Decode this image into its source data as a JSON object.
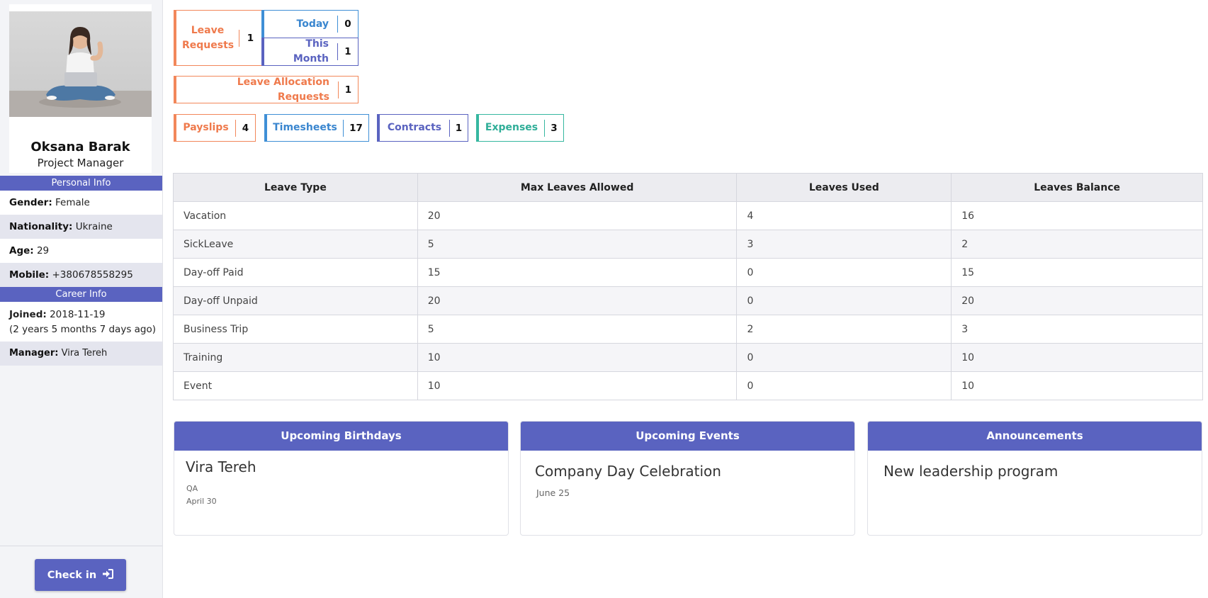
{
  "profile": {
    "name": "Oksana Barak",
    "role": "Project Manager"
  },
  "personal_info": {
    "heading": "Personal Info",
    "gender_label": "Gender:",
    "gender": "Female",
    "nationality_label": "Nationality:",
    "nationality": "Ukraine",
    "age_label": "Age:",
    "age": "29",
    "mobile_label": "Mobile:",
    "mobile": "+380678558295"
  },
  "career_info": {
    "heading": "Career Info",
    "joined_label": "Joined:",
    "joined": "2018-11-19",
    "joined_ago": "(2 years 5 months 7 days ago)",
    "manager_label": "Manager:",
    "manager": "Vira Tereh"
  },
  "checkin": {
    "label": "Check in",
    "icon": "sign-in-icon"
  },
  "stats": {
    "leave_requests": {
      "label": "Leave Requests",
      "value": "1"
    },
    "today": {
      "label": "Today",
      "value": "0"
    },
    "this_month": {
      "label": "This Month",
      "value": "1"
    },
    "allocation": {
      "label": "Leave Allocation Requests",
      "value": "1"
    },
    "payslips": {
      "label": "Payslips",
      "value": "4"
    },
    "timesheets": {
      "label": "Timesheets",
      "value": "17"
    },
    "contracts": {
      "label": "Contracts",
      "value": "1"
    },
    "expenses": {
      "label": "Expenses",
      "value": "3"
    }
  },
  "leave_table": {
    "headers": [
      "Leave Type",
      "Max Leaves Allowed",
      "Leaves Used",
      "Leaves Balance"
    ],
    "rows": [
      [
        "Vacation",
        "20",
        "4",
        "16"
      ],
      [
        "SickLeave",
        "5",
        "3",
        "2"
      ],
      [
        "Day-off Paid",
        "15",
        "0",
        "15"
      ],
      [
        "Day-off Unpaid",
        "20",
        "0",
        "20"
      ],
      [
        "Business Trip",
        "5",
        "2",
        "3"
      ],
      [
        "Training",
        "10",
        "0",
        "10"
      ],
      [
        "Event",
        "10",
        "0",
        "10"
      ]
    ]
  },
  "cards": {
    "birthdays": {
      "heading": "Upcoming Birthdays",
      "name": "Vira Tereh",
      "dept": "QA",
      "date": "April 30"
    },
    "events": {
      "heading": "Upcoming Events",
      "title": "Company Day Celebration",
      "date": "June 25"
    },
    "announcements": {
      "heading": "Announcements",
      "title": "New leadership program"
    }
  },
  "colors": {
    "accent": "#5a63c0",
    "orange": "#f2875a",
    "blue": "#3f8fd6",
    "teal": "#36b7a0"
  }
}
